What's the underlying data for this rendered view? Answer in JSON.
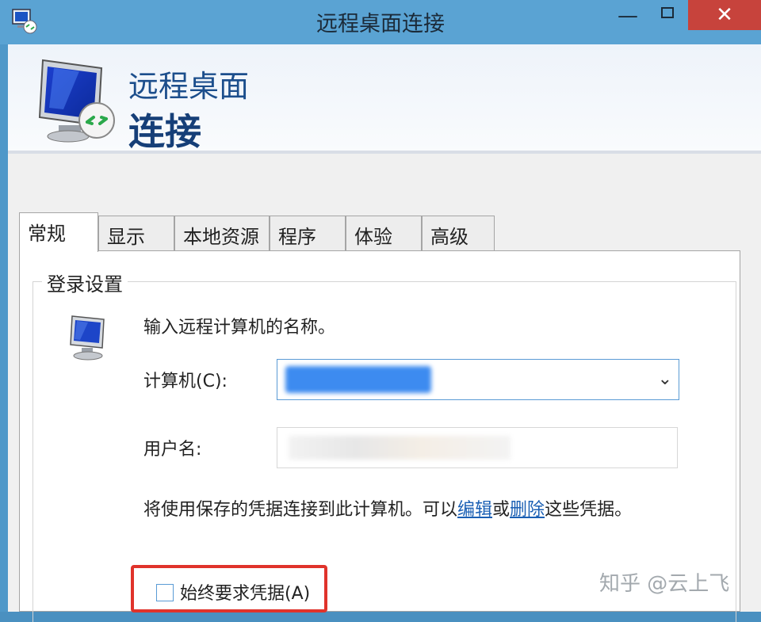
{
  "window": {
    "title": "远程桌面连接",
    "minimize_glyph": "—",
    "close_glyph": "✕"
  },
  "banner": {
    "line1": "远程桌面",
    "line2": "连接"
  },
  "tabs": [
    {
      "label": "常规",
      "active": true
    },
    {
      "label": "显示",
      "active": false
    },
    {
      "label": "本地资源",
      "active": false
    },
    {
      "label": "程序",
      "active": false
    },
    {
      "label": "体验",
      "active": false
    },
    {
      "label": "高级",
      "active": false
    }
  ],
  "login": {
    "group_label": "登录设置",
    "intro": "输入远程计算机的名称。",
    "computer_label": "计算机(C):",
    "user_label": "用户名:",
    "note_prefix": "将使用保存的凭据连接到此计算机。可以",
    "edit_link": "编辑",
    "or_text": "或",
    "delete_link": "删除",
    "note_suffix": "这些凭据。",
    "always_ask_label": "始终要求凭据(A)"
  },
  "watermark": "知乎 @云上飞",
  "icons": {
    "app": "remote-desktop-icon",
    "computer": "computer-icon",
    "dropdown": "chevron-down-icon"
  },
  "colors": {
    "titlebar": "#5aa3d3",
    "close": "#c7433c",
    "highlight": "#e0332b"
  }
}
